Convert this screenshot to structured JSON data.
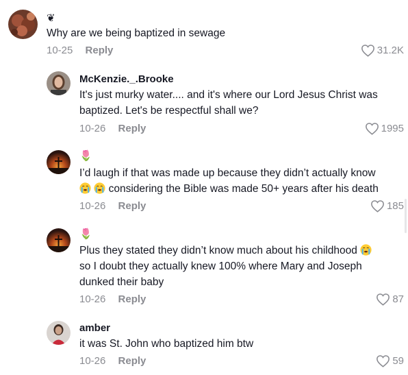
{
  "comments": [
    {
      "username": "",
      "name_emoji": "❦",
      "lines": [
        "Why are we being baptized in sewage"
      ],
      "date": "10-25",
      "reply_label": "Reply",
      "likes": "31.2K",
      "avatar": "brown-textured-avatar"
    },
    {
      "username": "McKenzie._.Brooke",
      "lines": [
        "It's just murky water.... and it's where our Lord Jesus Christ was",
        "baptized. Let's be respectful shall we?"
      ],
      "date": "10-26",
      "reply_label": "Reply",
      "likes": "1995",
      "avatar": "woman-portrait-avatar"
    },
    {
      "username": "",
      "name_emoji": "🌷",
      "line1": "I’d laugh if that was made up because they didn’t actually know",
      "line2_emoji": [
        "loudly-crying-face",
        "loudly-crying-face"
      ],
      "line2": "considering the Bible was made 50+ years after his death",
      "date": "10-26",
      "reply_label": "Reply",
      "likes": "185",
      "avatar": "sunset-cross-avatar"
    },
    {
      "username": "",
      "name_emoji": "🌷",
      "line1": "Plus they stated they didn’t know much about his childhood",
      "line1_emoji": "loudly-crying-face",
      "line2": "so I doubt they actually knew 100% where Mary and Joseph",
      "line3": "dunked their baby",
      "date": "10-26",
      "reply_label": "Reply",
      "likes": "87",
      "avatar": "sunset-cross-avatar"
    },
    {
      "username": "amber",
      "lines": [
        "it was St. John who baptized him btw"
      ],
      "date": "10-26",
      "reply_label": "Reply",
      "likes": "59",
      "avatar": "girl-red-shirt-avatar"
    }
  ]
}
